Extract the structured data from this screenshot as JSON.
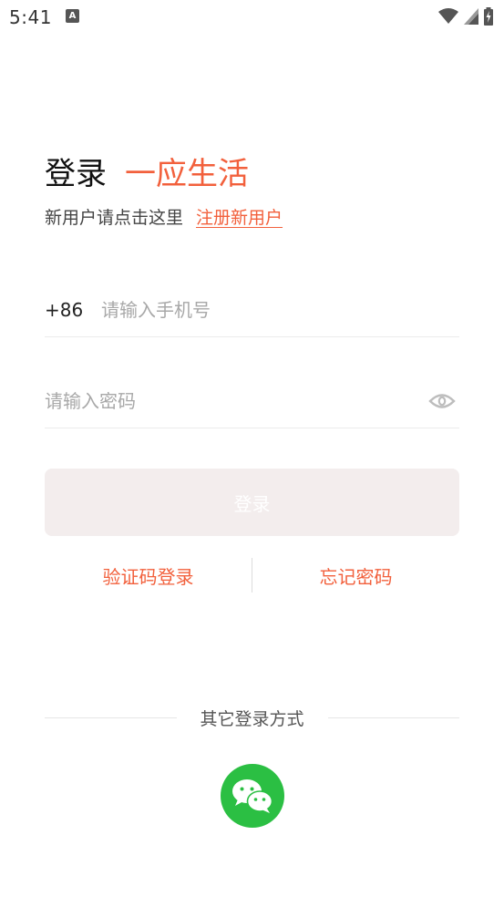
{
  "status_bar": {
    "time": "5:41",
    "notification_icon": "A"
  },
  "title": {
    "main": "登录",
    "brand": "一应生活"
  },
  "subtitle": {
    "text": "新用户请点击这里",
    "register_link": "注册新用户"
  },
  "phone_field": {
    "country_code": "+86",
    "placeholder": "请输入手机号",
    "value": ""
  },
  "password_field": {
    "placeholder": "请输入密码",
    "value": ""
  },
  "login_button": {
    "label": "登录"
  },
  "alt_links": {
    "sms_login": "验证码登录",
    "forgot_password": "忘记密码"
  },
  "other_login": {
    "label": "其它登录方式",
    "wechat_icon": "wechat-icon"
  },
  "colors": {
    "accent": "#f2603c",
    "button_disabled": "#f3eded",
    "wechat": "#2bbf43"
  }
}
